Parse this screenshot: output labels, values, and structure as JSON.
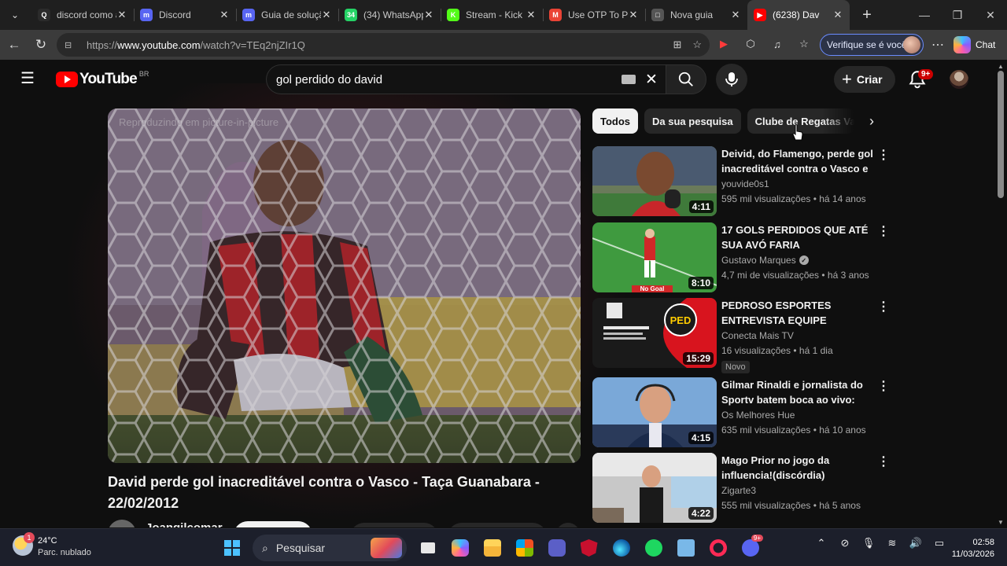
{
  "browser": {
    "tabs": [
      {
        "label": "discord como a",
        "favicon": "search",
        "color": "#2b2b2b",
        "glyph": "Q"
      },
      {
        "label": "Discord",
        "favicon": "discord",
        "color": "#5865f2",
        "glyph": "m"
      },
      {
        "label": "Guia de soluçã",
        "favicon": "discord",
        "color": "#5865f2",
        "glyph": "m"
      },
      {
        "label": "(34) WhatsApp",
        "favicon": "whatsapp",
        "color": "#25d366",
        "glyph": "34"
      },
      {
        "label": "Stream - Kick D",
        "favicon": "kick",
        "color": "#53fc18",
        "glyph": "K"
      },
      {
        "label": "Use OTP To Pre",
        "favicon": "gmail",
        "color": "#ea4335",
        "glyph": "M"
      },
      {
        "label": "Nova guia",
        "favicon": "newtab",
        "color": "#555555",
        "glyph": "□"
      },
      {
        "label": "(6238) Dav",
        "favicon": "youtube",
        "color": "#ff0000",
        "glyph": "▶",
        "active": true
      }
    ],
    "url_prefix": "https://",
    "url_host": "www.youtube.com",
    "url_path": "/watch?v=TEq2njZIr1Q",
    "profile_label": "Verifique se é você",
    "chat_label": "Chat"
  },
  "youtube": {
    "logo_text": "YouTube",
    "country_code": "BR",
    "search_query": "gol perdido do david",
    "create_label": "Criar",
    "notif_count": "9+",
    "pip_text": "Reproduzindo em picture-in-picture",
    "video_title": "David perde gol inacreditável contra o Vasco - Taça Guanabara - 22/02/2012",
    "channel_name": "Joangilcomar",
    "chips": [
      "Todos",
      "Da sua pesquisa",
      "Clube de Regatas Va"
    ],
    "recommendations": [
      {
        "title": "Deivid, do Flamengo, perde gol inacreditável contra o Vasco e ...",
        "channel": "youvide0s1",
        "meta": "595 mil visualizações • há 14 anos",
        "duration": "4:11",
        "verified": false,
        "badge": ""
      },
      {
        "title": "17 GOLS PERDIDOS QUE ATÉ SUA AVÓ FARIA",
        "channel": "Gustavo Marques",
        "meta": "4,7 mi de visualizações • há 3 anos",
        "duration": "8:10",
        "verified": true,
        "badge": ""
      },
      {
        "title": "PEDROSO ESPORTES ENTREVISTA EQUIPE TÉCNIC...",
        "channel": "Conecta Mais TV",
        "meta": "16 visualizações • há 1 dia",
        "duration": "15:29",
        "verified": false,
        "badge": "Novo"
      },
      {
        "title": "Gilmar Rinaldi e jornalista do Sportv batem boca ao vivo: \"M...",
        "channel": "Os Melhores Hue",
        "meta": "635 mil visualizações • há 10 anos",
        "duration": "4:15",
        "verified": false,
        "badge": ""
      },
      {
        "title": "Mago Prior no jogo da influencia!(discórdia)",
        "channel": "Zigarte3",
        "meta": "555 mil visualizações • há 5 anos",
        "duration": "4:22",
        "verified": false,
        "badge": ""
      }
    ]
  },
  "thumb_texts": {
    "no_goal": "No Goal",
    "ped_logo": "PED"
  },
  "taskbar": {
    "weather_temp": "24°C",
    "weather_desc": "Parc. nublado",
    "weather_badge": "1",
    "search_label": "Pesquisar",
    "discord_badge": "9+",
    "time": "02:58",
    "date": "11/03/2026"
  },
  "colors": {
    "youtube_red": "#ff0000",
    "accent_blue": "#6a8cff"
  }
}
